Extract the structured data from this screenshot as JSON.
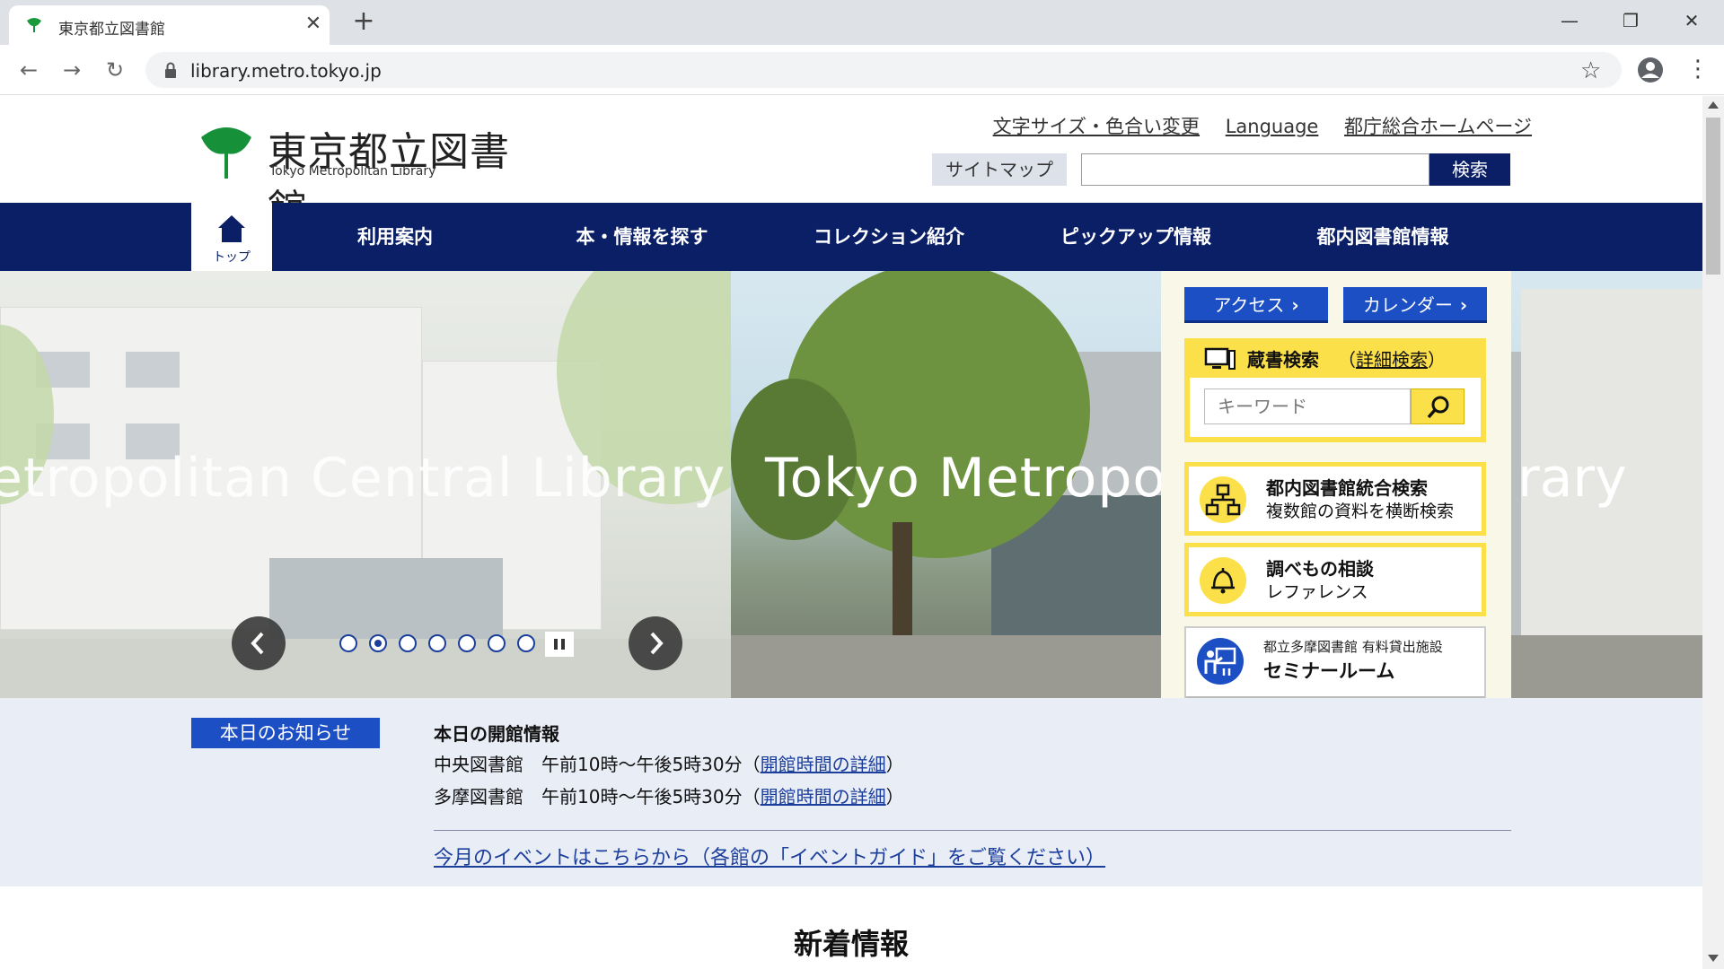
{
  "browser": {
    "tab_title": "東京都立図書館",
    "url": "library.metro.tokyo.jp",
    "minimize": "—",
    "restore": "❐",
    "close": "✕"
  },
  "header": {
    "logo_jp": "東京都立図書館",
    "logo_en": "Tokyo Metropolitan Library",
    "util_links": [
      "文字サイズ・色合い変更",
      "Language",
      "都庁総合ホームページ"
    ],
    "sitemap_label": "サイトマップ",
    "search_label": "検索"
  },
  "nav": {
    "home_label": "トップ",
    "items": [
      "利用案内",
      "本・情報を探す",
      "コレクション紹介",
      "ピックアップ情報",
      "都内図書館情報"
    ]
  },
  "hero": {
    "caption_left": "etropolitan Central Library",
    "caption_right": "Tokyo Metropoli",
    "caption_right_tail": "rary",
    "slide_count": 7,
    "active_slide": 2
  },
  "side": {
    "access_label": "アクセス",
    "calendar_label": "カレンダー",
    "catalog_title": "蔵書検索",
    "catalog_advanced_open": "（",
    "catalog_advanced": "詳細検索",
    "catalog_advanced_close": "）",
    "keyword_placeholder": "キーワード",
    "features": [
      {
        "title": "都内図書館統合検索",
        "sub": "複数館の資料を横断検索"
      },
      {
        "title": "調べもの相談",
        "sub": "レファレンス"
      }
    ],
    "seminar_small": "都立多摩図書館 有料貸出施設",
    "seminar_big": "セミナールーム"
  },
  "notice": {
    "tag": "本日のお知らせ",
    "open_title": "本日の開館情報",
    "rows": [
      {
        "lib": "中央図書館　午前10時～午後5時30分（",
        "link": "開館時間の詳細",
        "close": "）"
      },
      {
        "lib": "多摩図書館　午前10時～午後5時30分（",
        "link": "開館時間の詳細",
        "close": "）"
      }
    ],
    "event_link": "今月のイベントはこちらから（各館の「イベントガイド」をご覧ください）"
  },
  "news": {
    "title": "新着情報"
  },
  "colors": {
    "navy": "#0a1f66",
    "blue": "#1c4fc4",
    "yellow": "#fbe04a",
    "notice_bg": "#e9edf6"
  }
}
